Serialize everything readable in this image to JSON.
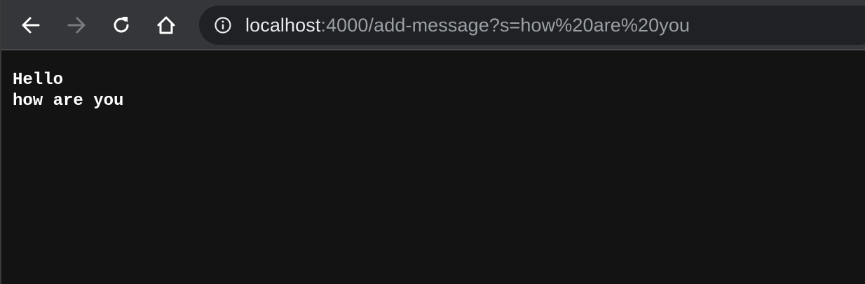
{
  "toolbar": {
    "back_icon": "arrow-left-icon",
    "forward_icon": "arrow-right-icon",
    "reload_icon": "reload-icon",
    "home_icon": "home-icon"
  },
  "omnibox": {
    "info_icon": "info-circle-icon",
    "url_host": "localhost",
    "url_rest": ":4000/add-message?s=how%20are%20you"
  },
  "page": {
    "lines": [
      "Hello",
      "how are you"
    ]
  },
  "colors": {
    "toolbar_bg": "#35363a",
    "omnibox_bg": "#202124",
    "page_bg": "#131313",
    "text_primary": "#e8eaed",
    "text_secondary": "#9aa0a6",
    "forward_disabled": "#7a7b7f"
  }
}
